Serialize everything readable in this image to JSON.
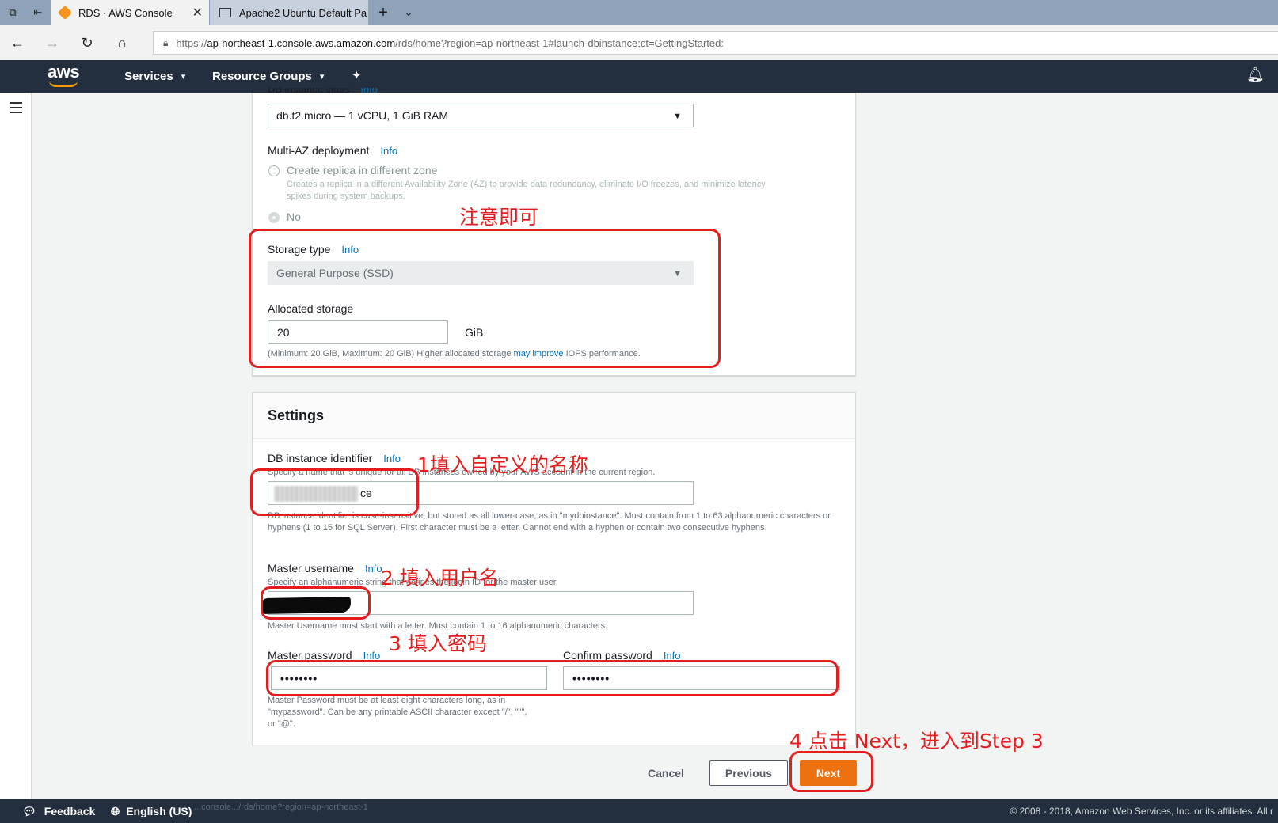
{
  "browser": {
    "tabs": [
      {
        "title": "RDS · AWS Console",
        "active": true
      },
      {
        "title": "Apache2 Ubuntu Default Pa",
        "active": false
      }
    ],
    "url_prefix": "https://",
    "url_host": "ap-northeast-1.console.aws.amazon.com",
    "url_path": "/rds/home?region=ap-northeast-1#launch-dbinstance:ct=GettingStarted:"
  },
  "aws_nav": {
    "logo": "aws",
    "services_label": "Services",
    "resource_groups_label": "Resource Groups"
  },
  "instance": {
    "class_label": "DB instance class",
    "class_info": "Info",
    "class_value": "db.t2.micro — 1 vCPU, 1 GiB RAM",
    "multi_az_label": "Multi-AZ deployment",
    "multi_az_info": "Info",
    "replica_option": "Create replica in different zone",
    "replica_desc_1": "Creates a replica in a different Availability Zone (AZ) to provide data redundancy, eliminate I/O freezes, and minimize latency",
    "replica_desc_2": "spikes during system backups.",
    "no_option": "No",
    "storage_type_label": "Storage type",
    "storage_type_info": "Info",
    "storage_type_value": "General Purpose (SSD)",
    "allocated_label": "Allocated storage",
    "allocated_value": "20",
    "allocated_unit": "GiB",
    "allocated_desc_pre": "(Minimum: 20 GiB, Maximum: 20 GiB) Higher allocated storage ",
    "allocated_desc_link": "may improve",
    "allocated_desc_post": " IOPS performance."
  },
  "settings": {
    "title": "Settings",
    "identifier_label": "DB instance identifier",
    "identifier_info": "Info",
    "identifier_desc": "Specify a name that is unique for all DB instances owned by your AWS account in the current region.",
    "identifier_value_suffix": "ce",
    "identifier_help": "DB instance identifier is case-insensitive, but stored as all lower-case, as in \"mydbinstance\". Must contain from 1 to 63 alphanumeric characters or hyphens (1 to 15 for SQL Server). First character must be a letter. Cannot end with a hyphen or contain two consecutive hyphens.",
    "username_label": "Master username",
    "username_info": "Info",
    "username_desc": "Specify an alphanumeric string that defines the login ID for the master user.",
    "username_help": "Master Username must start with a letter. Must contain 1 to 16 alphanumeric characters.",
    "password_label": "Master password",
    "password_info": "Info",
    "password_value": "••••••••",
    "confirm_label": "Confirm password",
    "confirm_info": "Info",
    "confirm_value": "••••••••",
    "password_help": "Master Password must be at least eight characters long, as in \"mypassword\". Can be any printable ASCII character except \"/\", \"\"\", or \"@\"."
  },
  "actions": {
    "cancel": "Cancel",
    "previous": "Previous",
    "next": "Next"
  },
  "footer": {
    "feedback": "Feedback",
    "language": "English (US)",
    "status_url": "...console.../rds/home?region=ap-northeast-1",
    "copyright": "© 2008 - 2018, Amazon Web Services, Inc. or its affiliates. All r"
  },
  "annotations": {
    "note": "注意即可",
    "step1": "1填入自定义的名称",
    "step2": "2 填入用户名",
    "step3": "3 填入密码",
    "step4": "4 点击 Next，进入到Step 3"
  },
  "colors": {
    "aws_nav": "#232f3e",
    "aws_orange": "#ec7211",
    "link": "#0073bb",
    "annotation_red": "#e41e1e"
  }
}
